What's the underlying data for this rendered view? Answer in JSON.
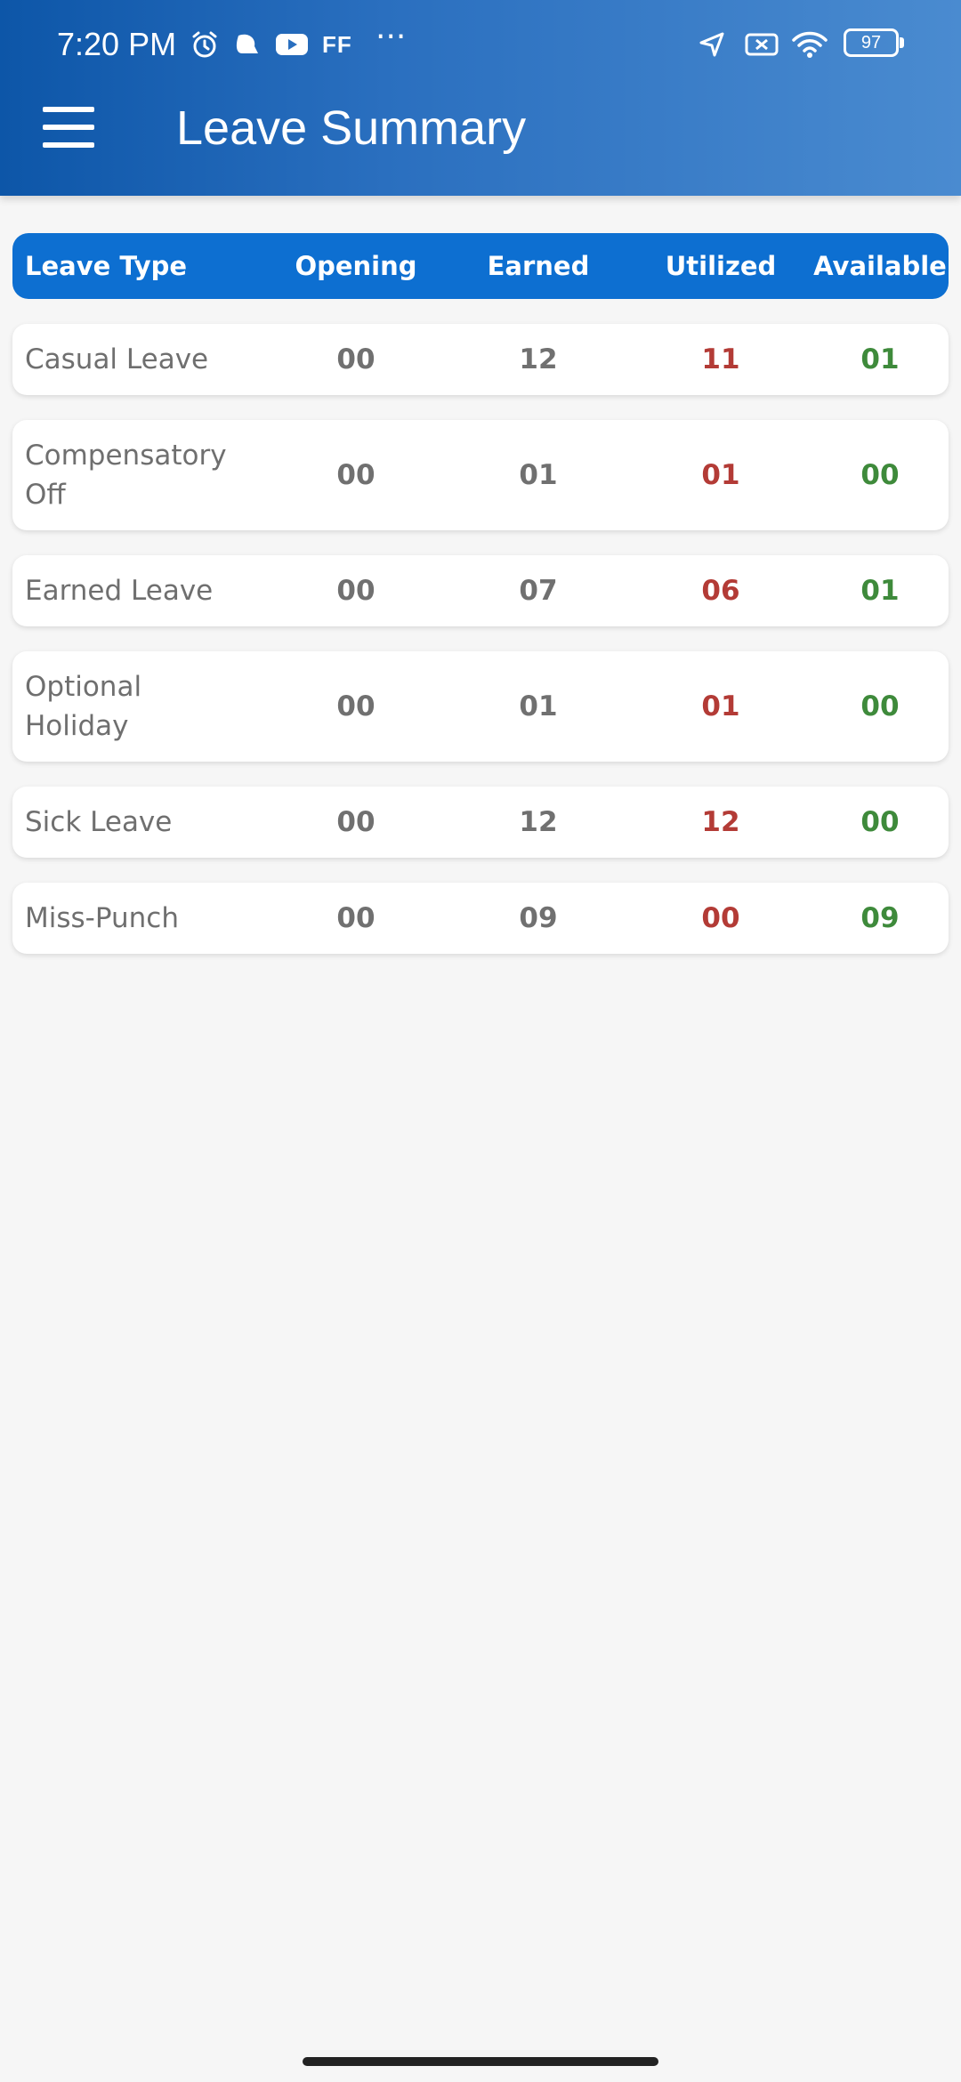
{
  "status_bar": {
    "time": "7:20 PM",
    "icons": [
      "alarm-icon",
      "notification-icon",
      "youtube-icon",
      "ff-icon",
      "more-icon",
      "location-icon",
      "no-sim-icon",
      "wifi-icon",
      "battery-icon"
    ],
    "ff_label": "FF",
    "more_label": "···",
    "battery_level": "97"
  },
  "app_bar": {
    "title": "Leave Summary",
    "menu_icon": "hamburger-menu-icon"
  },
  "table": {
    "headers": {
      "type": "Leave Type",
      "opening": "Opening",
      "earned": "Earned",
      "utilized": "Utilized",
      "available": "Available"
    },
    "rows": [
      {
        "type": "Casual Leave",
        "opening": "00",
        "earned": "12",
        "utilized": "11",
        "available": "01"
      },
      {
        "type": "Compensatory Off",
        "opening": "00",
        "earned": "01",
        "utilized": "01",
        "available": "00"
      },
      {
        "type": "Earned Leave",
        "opening": "00",
        "earned": "07",
        "utilized": "06",
        "available": "01"
      },
      {
        "type": "Optional Holiday",
        "opening": "00",
        "earned": "01",
        "utilized": "01",
        "available": "00"
      },
      {
        "type": "Sick Leave",
        "opening": "00",
        "earned": "12",
        "utilized": "12",
        "available": "00"
      },
      {
        "type": "Miss-Punch",
        "opening": "00",
        "earned": "09",
        "utilized": "00",
        "available": "09"
      }
    ]
  },
  "colors": {
    "header_background": "#0d6fd1",
    "app_bar_start": "#0d56a8",
    "app_bar_end": "#4a8bd0",
    "utilized_text": "#b33b36",
    "available_text": "#3e8a3b",
    "neutral_text": "#707070"
  }
}
